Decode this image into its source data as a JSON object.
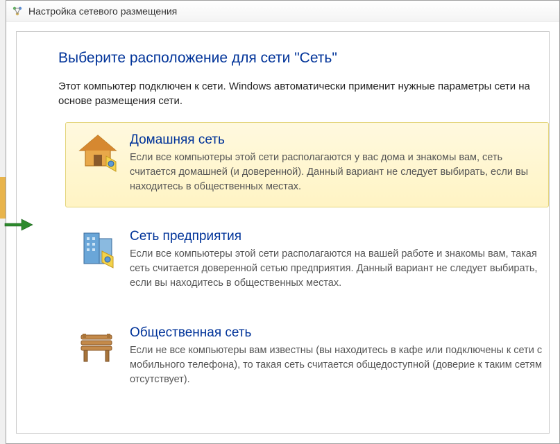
{
  "window": {
    "title": "Настройка сетевого размещения"
  },
  "page": {
    "heading": "Выберите расположение для сети \"Сеть\"",
    "intro": "Этот компьютер подключен к сети. Windows автоматически применит нужные параметры сети на основе размещения сети."
  },
  "options": [
    {
      "icon": "home-network-icon",
      "title": "Домашняя сеть",
      "desc": "Если все компьютеры этой сети располагаются у вас дома и знакомы вам, сеть считается домашней (и доверенной). Данный вариант не следует выбирать, если вы находитесь в общественных местах.",
      "highlighted": true
    },
    {
      "icon": "work-network-icon",
      "title": "Сеть предприятия",
      "desc": "Если все компьютеры этой сети располагаются на вашей работе и знакомы вам, такая сеть считается доверенной сетью предприятия. Данный вариант не следует выбирать, если вы находитесь в общественных местах.",
      "highlighted": false
    },
    {
      "icon": "public-network-icon",
      "title": "Общественная сеть",
      "desc": "Если не все компьютеры вам известны (вы находитесь в кафе или подключены к сети с мобильного телефона), то такая сеть считается общедоступной (доверие к таким сетям отсутствует).",
      "highlighted": false
    }
  ]
}
